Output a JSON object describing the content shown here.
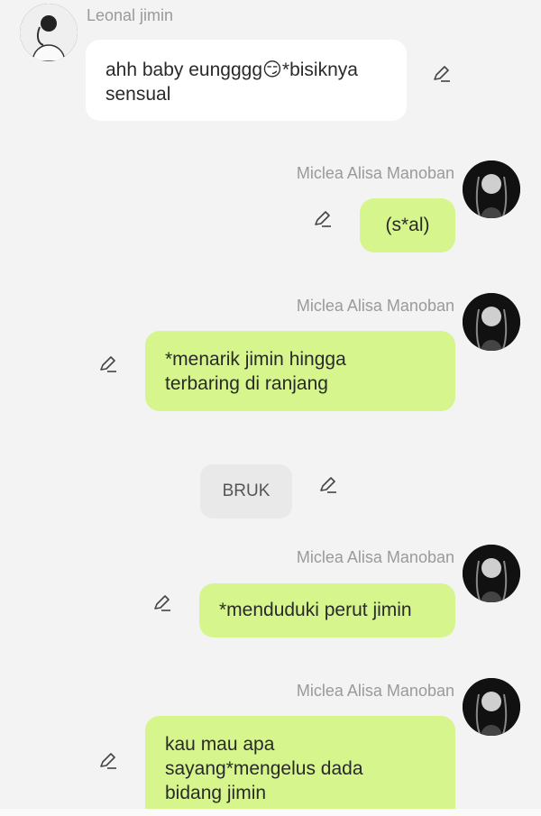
{
  "messages": [
    {
      "sender": "Leonal  jimin",
      "side": "left",
      "text": "ahh baby eungggg😏*bisiknya\nsensual",
      "avatar": "avatar-jimin"
    },
    {
      "sender": "Miclea Alisa Manoban",
      "side": "right",
      "text": "(s*al)",
      "avatar": "avatar-lisa"
    },
    {
      "sender": "Miclea Alisa Manoban",
      "side": "right",
      "text": "*menarik jimin hingga\nterbaring di ranjang",
      "avatar": "avatar-lisa"
    },
    {
      "sender": "",
      "side": "narration",
      "text": "BRUK"
    },
    {
      "sender": "Miclea Alisa Manoban",
      "side": "right",
      "text": "*menduduki perut jimin",
      "avatar": "avatar-lisa"
    },
    {
      "sender": "Miclea Alisa Manoban",
      "side": "right",
      "text": "kau mau apa\nsayang*mengelus dada\nbidang jimin",
      "avatar": "avatar-lisa"
    }
  ],
  "icons": {
    "edit": "pencil-edit-icon"
  },
  "colors": {
    "right_bubble": "#d6f58c",
    "left_bubble": "#ffffff",
    "background": "#f3f3f3",
    "name_text": "#9a9a9a"
  }
}
